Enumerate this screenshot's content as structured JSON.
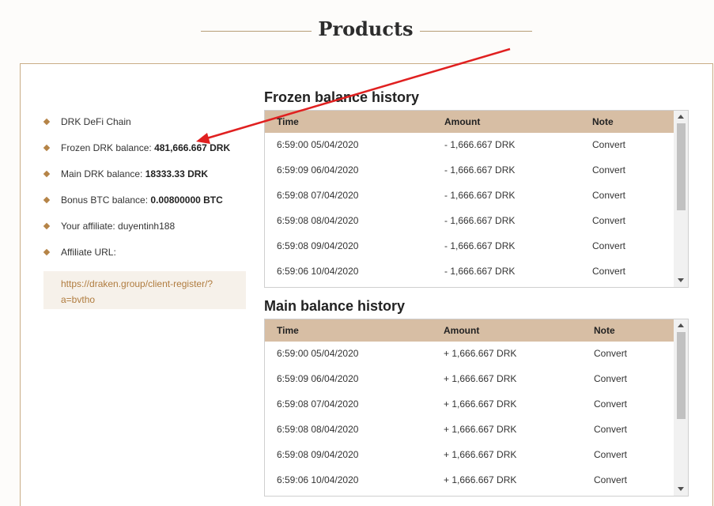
{
  "header": {
    "title": "Products"
  },
  "info": {
    "chain": "DRK DeFi Chain",
    "frozen_label": "Frozen DRK balance: ",
    "frozen_value": "481,666.667 DRK",
    "main_label": "Main DRK balance: ",
    "main_value": "18333.33 DRK",
    "bonus_label": "Bonus BTC balance: ",
    "bonus_value": "0.00800000 BTC",
    "affiliate_label": "Your affiliate: duyentinh188",
    "url_label": "Affiliate URL:",
    "url_line1": "https://draken.group/client-register/?",
    "url_line2": "a=bvtho"
  },
  "frozen_history": {
    "title": "Frozen balance history",
    "headers": {
      "time": "Time",
      "amount": "Amount",
      "note": "Note"
    },
    "rows": [
      {
        "time": "6:59:00 05/04/2020",
        "amount": "- 1,666.667 DRK",
        "note": "Convert"
      },
      {
        "time": "6:59:09 06/04/2020",
        "amount": "- 1,666.667 DRK",
        "note": "Convert"
      },
      {
        "time": "6:59:08 07/04/2020",
        "amount": "- 1,666.667 DRK",
        "note": "Convert"
      },
      {
        "time": "6:59:08 08/04/2020",
        "amount": "- 1,666.667 DRK",
        "note": "Convert"
      },
      {
        "time": "6:59:08 09/04/2020",
        "amount": "- 1,666.667 DRK",
        "note": "Convert"
      },
      {
        "time": "6:59:06 10/04/2020",
        "amount": "- 1,666.667 DRK",
        "note": "Convert"
      }
    ]
  },
  "main_history": {
    "title": "Main balance history",
    "headers": {
      "time": "Time",
      "amount": "Amount",
      "note": "Note"
    },
    "rows": [
      {
        "time": "6:59:00 05/04/2020",
        "amount": "+ 1,666.667 DRK",
        "note": "Convert"
      },
      {
        "time": "6:59:09 06/04/2020",
        "amount": "+ 1,666.667 DRK",
        "note": "Convert"
      },
      {
        "time": "6:59:08 07/04/2020",
        "amount": "+ 1,666.667 DRK",
        "note": "Convert"
      },
      {
        "time": "6:59:08 08/04/2020",
        "amount": "+ 1,666.667 DRK",
        "note": "Convert"
      },
      {
        "time": "6:59:08 09/04/2020",
        "amount": "+ 1,666.667 DRK",
        "note": "Convert"
      },
      {
        "time": "6:59:06 10/04/2020",
        "amount": "+ 1,666.667 DRK",
        "note": "Convert"
      }
    ]
  },
  "colors": {
    "accent": "#b58447",
    "table_header": "#d7bea4",
    "link": "#b07c3f",
    "annotation_arrow": "#e02020"
  },
  "icons": {
    "bullet": "diamond-bullet-icon",
    "annotation": "red-arrow-icon"
  }
}
